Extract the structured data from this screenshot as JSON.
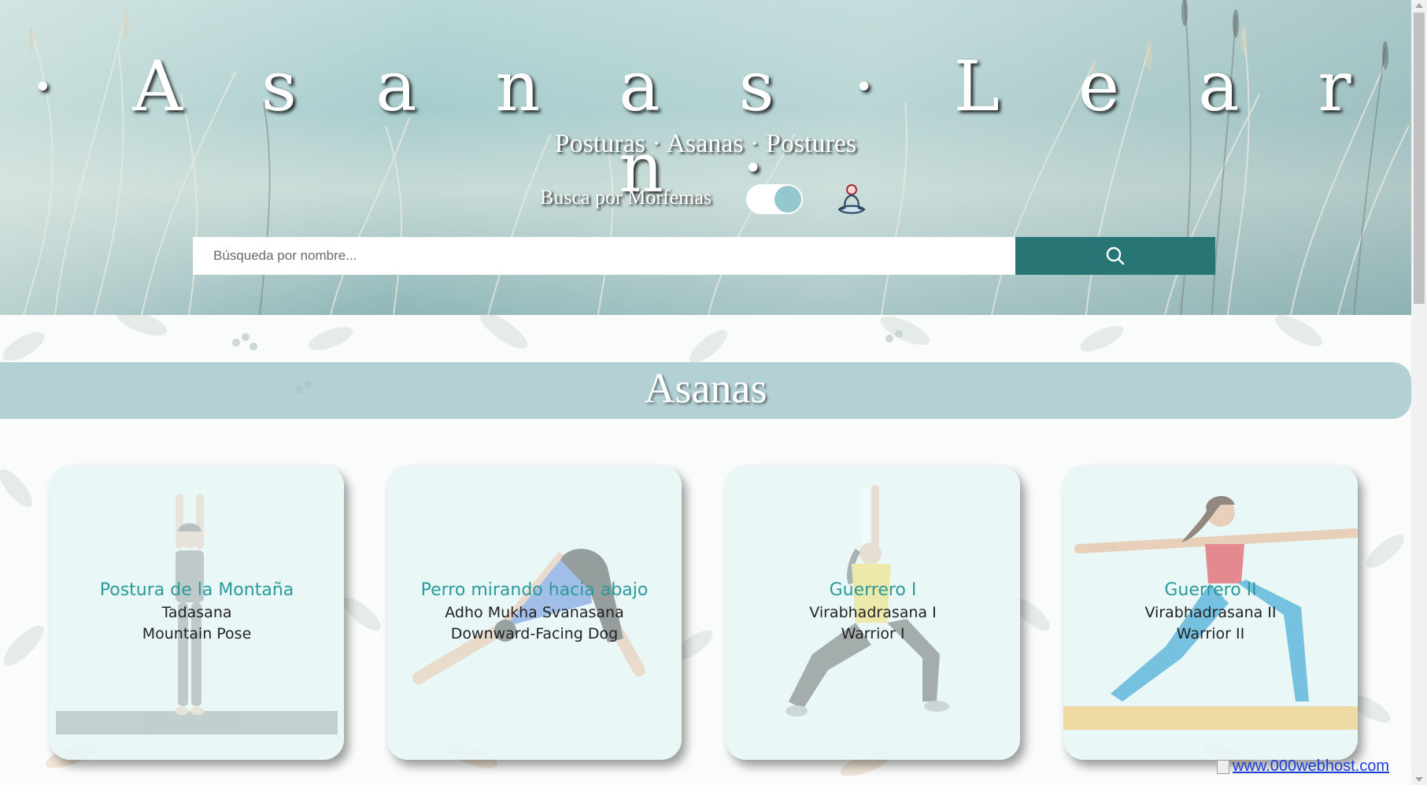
{
  "header": {
    "title": "· A s a n a s · L e a r n ·",
    "subtitle": "Posturas · Asanas · Postures",
    "morpheme_toggle_label": "Busca por Morfemas",
    "morpheme_toggle_state": "on",
    "search": {
      "placeholder": "Búsqueda por nombre...",
      "value": "",
      "button_icon": "search-icon"
    },
    "yogi_icon": "meditation-icon"
  },
  "section": {
    "title": "Asanas"
  },
  "cards": [
    {
      "name": "Postura de la Montaña",
      "sanskrit": "Tadasana",
      "english": "Mountain Pose"
    },
    {
      "name": "Perro mirando hacia abajo",
      "sanskrit": "Adho Mukha Svanasana",
      "english": "Downward-Facing Dog"
    },
    {
      "name": "Guerrero I",
      "sanskrit": "Virabhadrasana I",
      "english": "Warrior I"
    },
    {
      "name": "Guerrero II",
      "sanskrit": "Virabhadrasana II",
      "english": "Warrior II"
    }
  ],
  "footer": {
    "host_link": "www.000webhost.com"
  },
  "colors": {
    "accent": "#287575",
    "card_title": "#2a9a9b",
    "section_band": "#a4c7cc",
    "toggle_knob": "#93c8ce"
  }
}
